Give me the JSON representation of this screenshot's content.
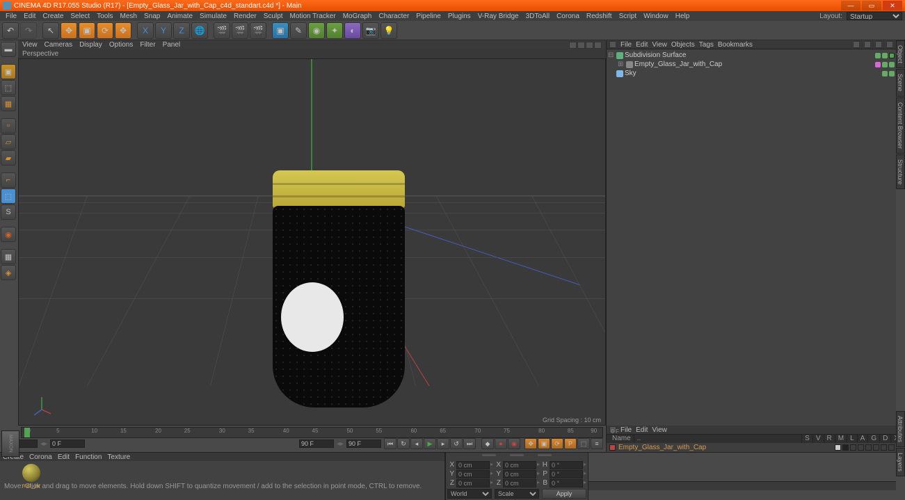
{
  "title": "CINEMA 4D R17.055 Studio (R17) - [Empty_Glass_Jar_with_Cap_c4d_standart.c4d *] - Main",
  "menus": [
    "File",
    "Edit",
    "Create",
    "Select",
    "Tools",
    "Mesh",
    "Snap",
    "Animate",
    "Simulate",
    "Render",
    "Sculpt",
    "Motion Tracker",
    "MoGraph",
    "Character",
    "Pipeline",
    "Plugins",
    "V-Ray Bridge",
    "3DToAll",
    "Corona",
    "Redshift",
    "Script",
    "Window",
    "Help"
  ],
  "layout_label": "Layout:",
  "layout_value": "Startup",
  "vp_menus": [
    "View",
    "Cameras",
    "Display",
    "Options",
    "Filter",
    "Panel"
  ],
  "vp_label": "Perspective",
  "grid_spacing": "Grid Spacing : 10 cm",
  "ruler_ticks": [
    "0",
    "5",
    "10",
    "15",
    "20",
    "25",
    "30",
    "35",
    "40",
    "45",
    "50",
    "55",
    "60",
    "65",
    "70",
    "75",
    "80",
    "85",
    "90"
  ],
  "ruler_end": "0 F",
  "frame_start": "0 F",
  "frame_mid": "0 F",
  "frame_in": "90 F",
  "frame_out": "90 F",
  "mat_menus": [
    "Create",
    "Corona",
    "Edit",
    "Function",
    "Texture"
  ],
  "mat_name": "mat_jar",
  "coord": {
    "x": "0 cm",
    "sx": "0 cm",
    "h": "0 °",
    "y": "0 cm",
    "sy": "0 cm",
    "p": "0 °",
    "z": "0 cm",
    "sz": "0 cm",
    "b": "0 °",
    "space": "World",
    "scale": "Scale",
    "apply": "Apply"
  },
  "obj_menus": [
    "File",
    "Edit",
    "View",
    "Objects",
    "Tags",
    "Bookmarks"
  ],
  "tree": [
    {
      "name": "Subdivision Surface",
      "icon": "#5faf7f",
      "indent": 0
    },
    {
      "name": "Empty_Glass_Jar_with_Cap",
      "icon": "#c888e8",
      "indent": 1,
      "sel": true
    },
    {
      "name": "Sky",
      "icon": "#7fb8e8",
      "indent": 0
    }
  ],
  "attr_menus": [
    "File",
    "Edit",
    "View"
  ],
  "attr_cols": [
    "Name",
    "..",
    "S",
    "V",
    "R",
    "M",
    "L",
    "A",
    "G",
    "D",
    "X"
  ],
  "attr_item": "Empty_Glass_Jar_with_Cap",
  "side_tabs_r": [
    "Object",
    "Scene",
    "Content Browser",
    "Structure"
  ],
  "side_tabs_b": [
    "Attributes",
    "Layers"
  ],
  "status": "Move: Click and drag to move elements. Hold down SHIFT to quantize movement / add to the selection in point mode, CTRL to remove."
}
